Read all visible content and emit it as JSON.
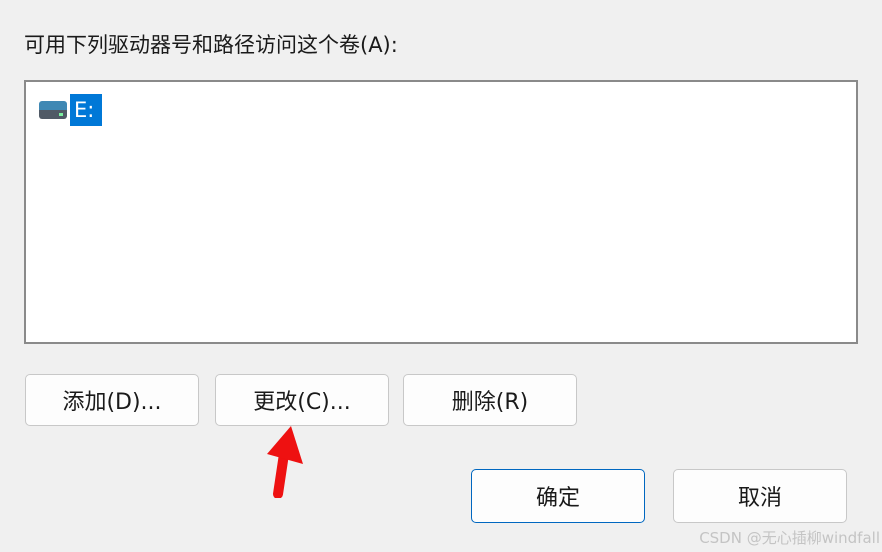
{
  "dialog": {
    "instruction": "可用下列驱动器号和路径访问这个卷(A):"
  },
  "listbox": {
    "items": [
      {
        "label": "E:",
        "icon": "drive-icon",
        "selected": true
      }
    ]
  },
  "buttons": {
    "add": "添加(D)...",
    "change": "更改(C)...",
    "remove": "删除(R)",
    "ok": "确定",
    "cancel": "取消"
  },
  "annotation": {
    "arrow_color": "#ee1111"
  },
  "watermark": "CSDN @无心插柳windfall",
  "colors": {
    "selection": "#0078d7",
    "window_bg": "#f0f0f0",
    "primary_border": "#0067c0"
  }
}
